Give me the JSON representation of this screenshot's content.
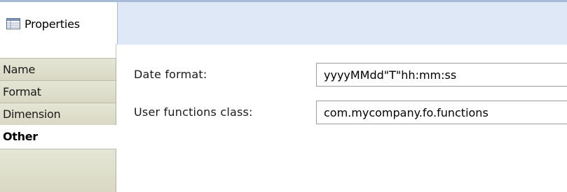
{
  "panel": {
    "tab_title": "Properties",
    "tab_icon": "properties-table-icon"
  },
  "sections": [
    {
      "label": "Name",
      "selected": false
    },
    {
      "label": "Format",
      "selected": false
    },
    {
      "label": "Dimension",
      "selected": false
    },
    {
      "label": "Other",
      "selected": true
    }
  ],
  "fields": {
    "date_format": {
      "label": "Date format:",
      "value": "yyyyMMdd\"T\"hh:mm:ss"
    },
    "user_functions_class": {
      "label": "User functions class:",
      "value": "com.mycompany.fo.functions"
    }
  },
  "colors": {
    "tab_strip": "#dfe8f6",
    "section_tab": "#dcdccb",
    "border": "#a9bad6"
  }
}
